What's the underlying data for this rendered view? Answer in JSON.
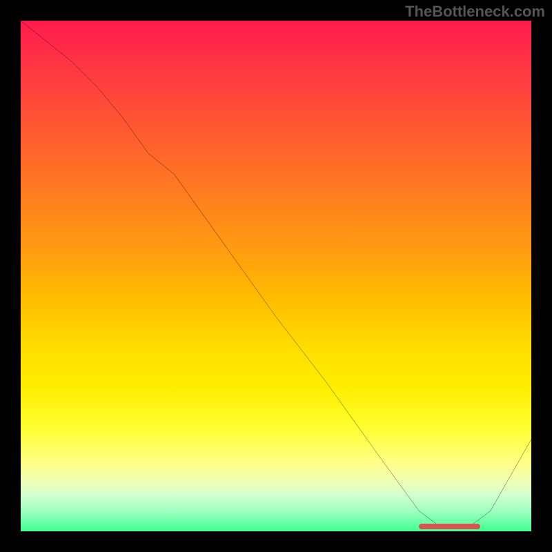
{
  "watermark": "TheBottleneck.com",
  "chart_data": {
    "type": "line",
    "title": "",
    "xlabel": "",
    "ylabel": "",
    "xlim": [
      0,
      100
    ],
    "ylim": [
      0,
      100
    ],
    "series": [
      {
        "name": "curve",
        "x": [
          0,
          5,
          10,
          15,
          20,
          25,
          30,
          40,
          50,
          60,
          70,
          78,
          82,
          88,
          92,
          100
        ],
        "y": [
          100,
          96,
          92,
          87,
          81,
          74,
          70,
          56,
          42,
          29,
          15,
          4,
          1,
          1,
          4,
          18
        ]
      }
    ],
    "annotations": [
      {
        "name": "flat-marker",
        "x_start": 78,
        "x_end": 90,
        "y": 1
      }
    ],
    "background_gradient": {
      "direction": "vertical",
      "stops": [
        {
          "pos": 0.0,
          "color": "#ff1a4d"
        },
        {
          "pos": 0.5,
          "color": "#ffbb00"
        },
        {
          "pos": 0.8,
          "color": "#ffff33"
        },
        {
          "pos": 1.0,
          "color": "#40ff90"
        }
      ]
    }
  }
}
